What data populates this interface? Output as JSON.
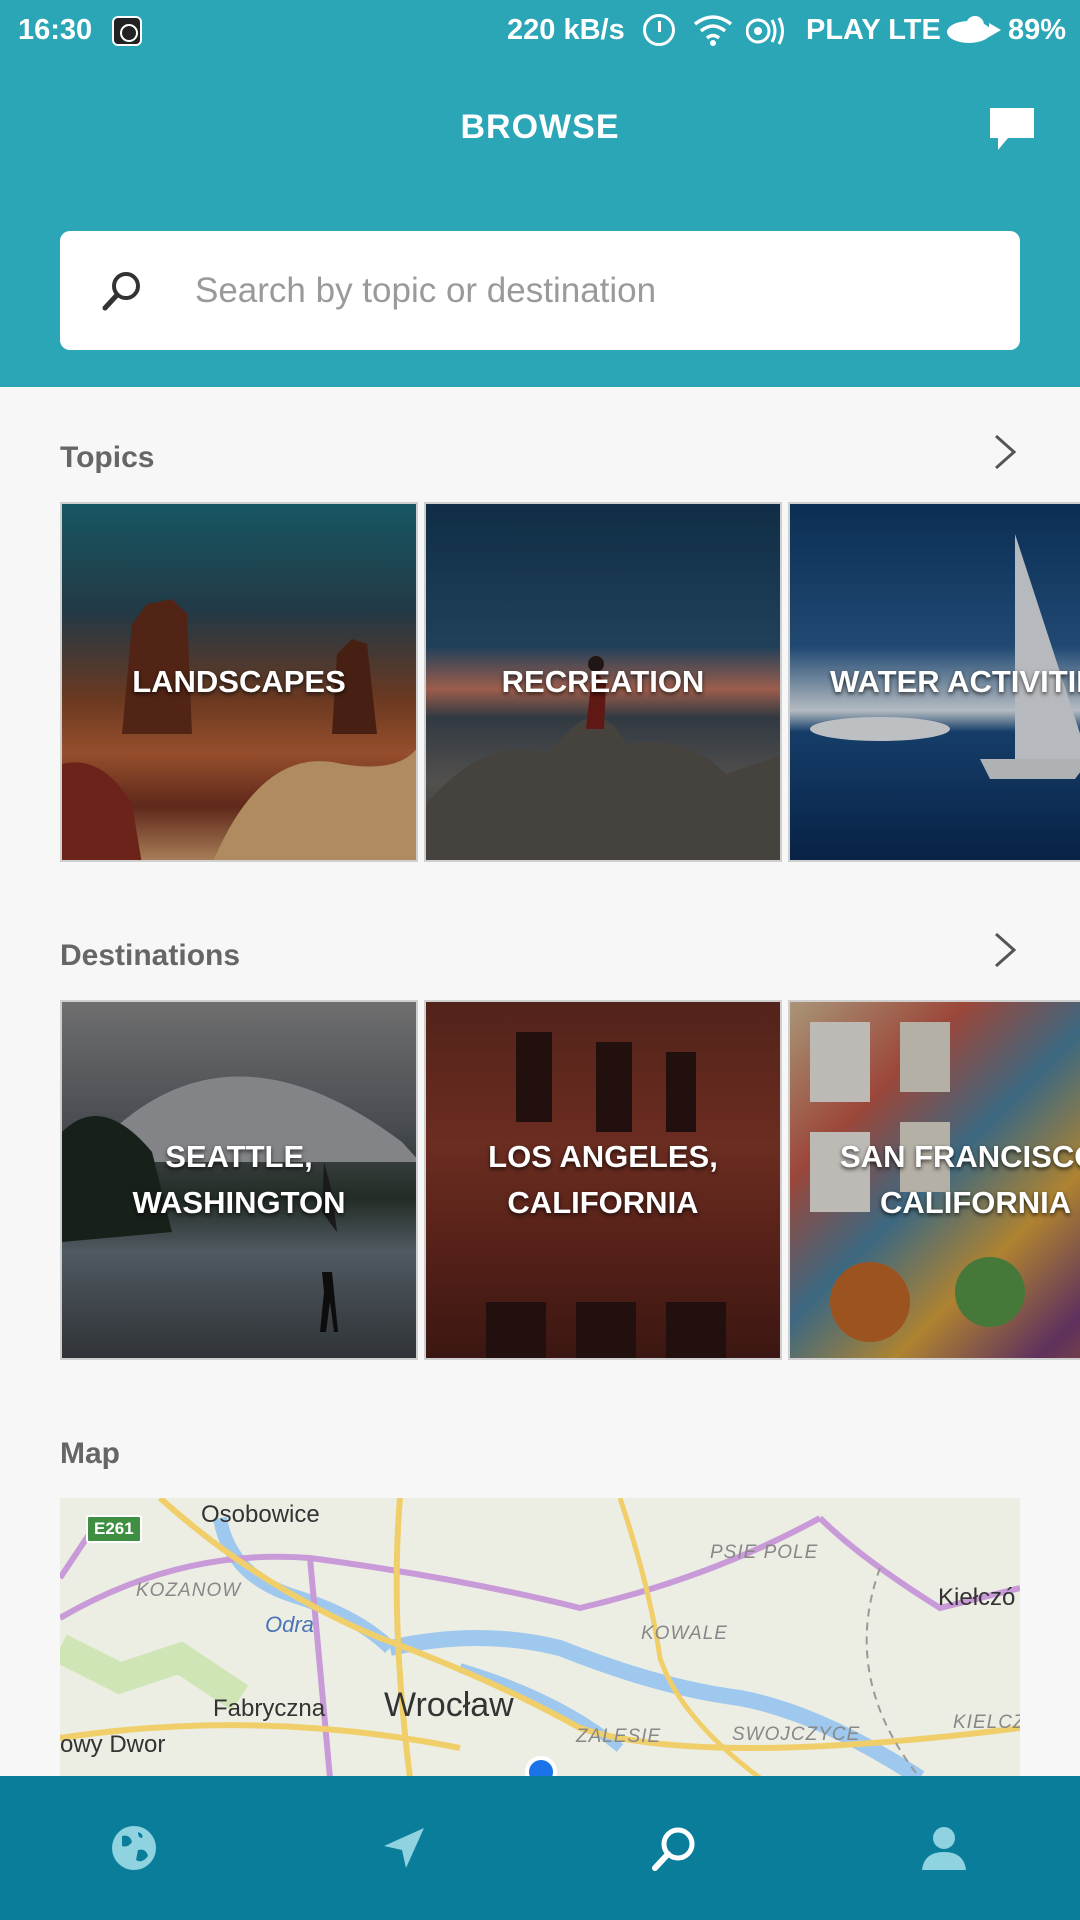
{
  "status_bar": {
    "time": "16:30",
    "network_speed": "220 kB/s",
    "carrier": "PLAY LTE",
    "battery": "89%",
    "icons": [
      "app-icon",
      "alarm-icon",
      "wifi-icon",
      "nfc-icon",
      "cloud-icon"
    ]
  },
  "header": {
    "title": "BROWSE",
    "chat_icon": "chat-icon"
  },
  "search": {
    "placeholder": "Search by topic or destination",
    "value": "",
    "icon": "search-icon"
  },
  "topics": {
    "title": "Topics",
    "items": [
      {
        "label": "LANDSCAPES"
      },
      {
        "label": "RECREATION"
      },
      {
        "label": "WATER ACTIVITIES"
      }
    ]
  },
  "destinations": {
    "title": "Destinations",
    "items": [
      {
        "line1": "SEATTLE,",
        "line2": "WASHINGTON"
      },
      {
        "line1": "LOS ANGELES,",
        "line2": "CALIFORNIA"
      },
      {
        "line1": "SAN FRANCISCO,",
        "line2": "CALIFORNIA"
      }
    ]
  },
  "map": {
    "title": "Map",
    "road_badge": "E261",
    "labels": {
      "osobowice": "Osobowice",
      "kozanow": "KOZANOW",
      "odra": "Odra",
      "fabryczna": "Fabryczna",
      "wroclaw": "Wrocław",
      "owy_dwor": "owy Dwor",
      "psie_pole": "PSIE POLE",
      "kowale": "KOWALE",
      "zalesie": "ZALESIE",
      "swojczyce": "SWOJCZYCE",
      "kielczow_top": "Kiełczó",
      "kielczow_bottom": "KIELCZ"
    }
  },
  "bottom_nav": {
    "items": [
      "globe-icon",
      "navigation-icon",
      "search-icon",
      "profile-icon"
    ],
    "active": "search-icon",
    "colors": {
      "background": "#0a7d9a",
      "icon": "#8fd3e0",
      "active": "#ffffff"
    }
  },
  "colors": {
    "header": "#2aa6b6",
    "background": "#f7f7f7"
  }
}
